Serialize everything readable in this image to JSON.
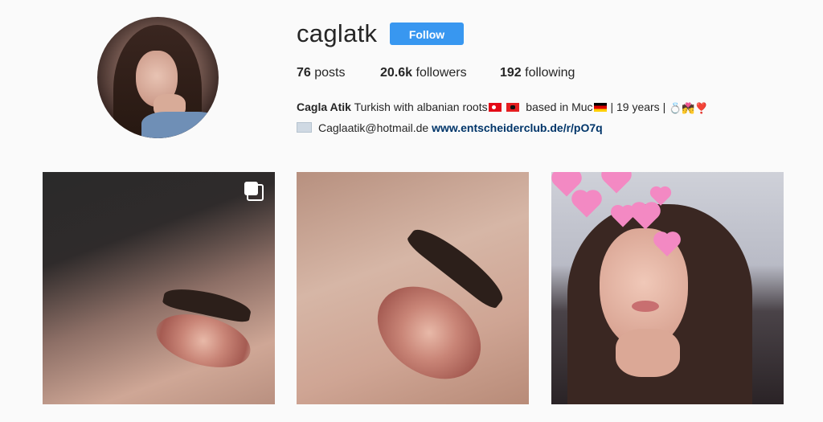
{
  "profile": {
    "username": "caglatk",
    "follow_label": "Follow",
    "stats": {
      "posts_count": "76",
      "posts_label": "posts",
      "followers_count": "20.6k",
      "followers_label": "followers",
      "following_count": "192",
      "following_label": "following"
    },
    "bio": {
      "name": "Cagla Atik",
      "text_1": "Turkish with albanian roots",
      "text_2": "based in Muc",
      "text_3": "| 19 years |",
      "email": "Caglaatik@hotmail.de",
      "link": "www.entscheiderclub.de/r/pO7q",
      "emoji_tail": "💍💏❣️"
    }
  },
  "posts": [
    {
      "label": "eye-makeup-closeup-1",
      "multiple": true
    },
    {
      "label": "eye-makeup-closeup-2",
      "multiple": false
    },
    {
      "label": "selfie-hearts-filter",
      "multiple": false
    }
  ],
  "colors": {
    "follow_button": "#3897f0",
    "link": "#003569",
    "background": "#fafafa"
  }
}
